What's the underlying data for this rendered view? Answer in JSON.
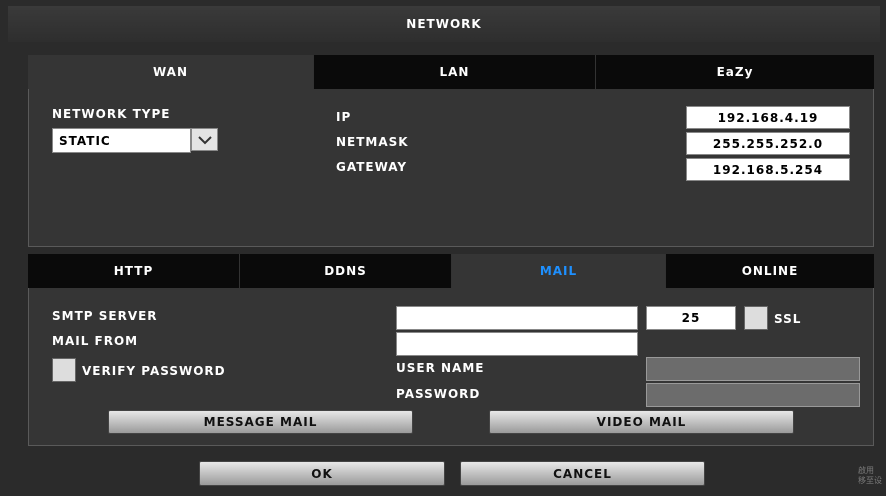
{
  "title": "NETWORK",
  "top_tabs": [
    {
      "label": "WAN"
    },
    {
      "label": "LAN"
    },
    {
      "label": "EaZy"
    }
  ],
  "wan": {
    "network_type_label": "NETWORK TYPE",
    "network_type_value": "STATIC",
    "ip_label": "IP",
    "ip_value": "192.168.4.19",
    "netmask_label": "NETMASK",
    "netmask_value": "255.255.252.0",
    "gateway_label": "GATEWAY",
    "gateway_value": "192.168.5.254"
  },
  "sub_tabs": [
    {
      "label": "HTTP"
    },
    {
      "label": "DDNS"
    },
    {
      "label": "MAIL"
    },
    {
      "label": "ONLINE"
    }
  ],
  "mail": {
    "smtp_server_label": "SMTP SERVER",
    "smtp_server_value": "",
    "port_value": "25",
    "ssl_label": "SSL",
    "mail_from_label": "MAIL FROM",
    "mail_from_value": "",
    "verify_password_label": "VERIFY PASSWORD",
    "user_name_label": "USER NAME",
    "password_label": "PASSWORD",
    "message_mail_label": "MESSAGE MAIL",
    "video_mail_label": "VIDEO MAIL"
  },
  "footer": {
    "ok_label": "OK",
    "cancel_label": "CANCEL"
  },
  "watermark": {
    "line1": "啟用",
    "line2": "移至设"
  },
  "colors": {
    "active_tab_text": "#1e90ff",
    "background": "#2b2b2b",
    "panel": "#353535"
  }
}
